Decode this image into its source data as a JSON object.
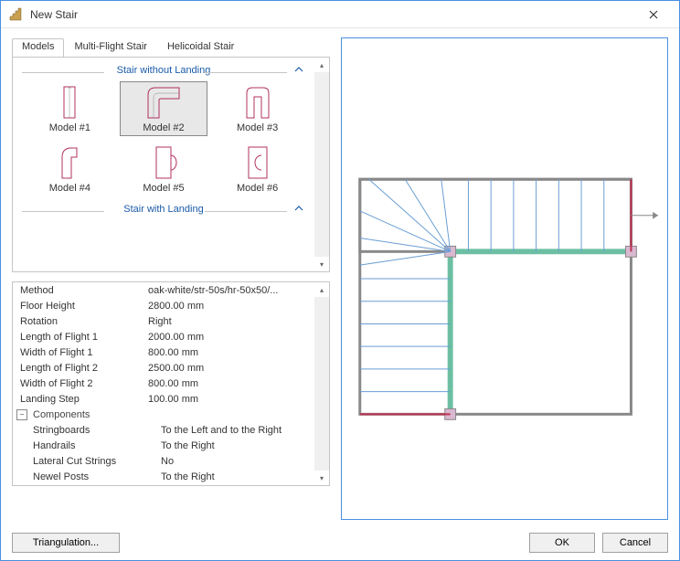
{
  "window": {
    "title": "New Stair"
  },
  "tabs": [
    {
      "label": "Models",
      "active": true
    },
    {
      "label": "Multi-Flight Stair",
      "active": false
    },
    {
      "label": "Helicoidal Stair",
      "active": false
    }
  ],
  "categories": {
    "noLanding": {
      "title": "Stair without Landing"
    },
    "withLanding": {
      "title": "Stair with Landing"
    }
  },
  "models": [
    {
      "label": "Model #1"
    },
    {
      "label": "Model #2"
    },
    {
      "label": "Model #3"
    },
    {
      "label": "Model #4"
    },
    {
      "label": "Model #5"
    },
    {
      "label": "Model #6"
    }
  ],
  "properties": {
    "method": {
      "label": "Method",
      "value": "oak-white/str-50s/hr-50x50/..."
    },
    "floorHeight": {
      "label": "Floor Height",
      "value": "2800.00 mm"
    },
    "rotation": {
      "label": "Rotation",
      "value": "Right"
    },
    "lenFlight1": {
      "label": "Length of Flight 1",
      "value": "2000.00 mm"
    },
    "widFlight1": {
      "label": "Width of Flight 1",
      "value": "800.00 mm"
    },
    "lenFlight2": {
      "label": "Length of Flight 2",
      "value": "2500.00 mm"
    },
    "widFlight2": {
      "label": "Width of Flight 2",
      "value": "800.00 mm"
    },
    "landingStep": {
      "label": "Landing Step",
      "value": "100.00 mm"
    },
    "componentsGroup": "Components",
    "stringboards": {
      "label": "Stringboards",
      "value": "To the Left and to the Right"
    },
    "handrails": {
      "label": "Handrails",
      "value": "To the Right"
    },
    "lateralCut": {
      "label": "Lateral Cut Strings",
      "value": "No"
    },
    "newelPosts": {
      "label": "Newel Posts",
      "value": "To the Right"
    }
  },
  "buttons": {
    "triangulation": "Triangulation...",
    "ok": "OK",
    "cancel": "Cancel"
  }
}
